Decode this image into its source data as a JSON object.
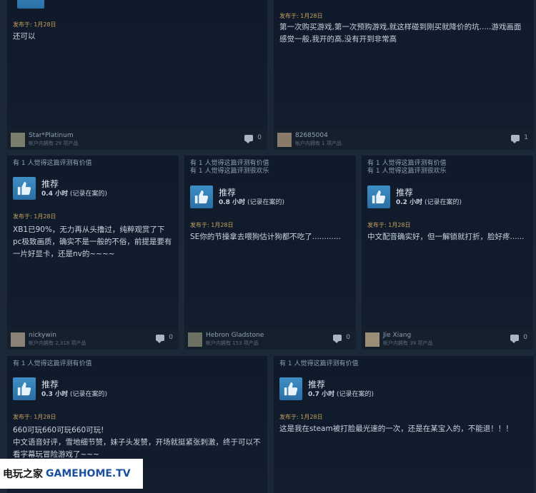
{
  "cards": [
    {
      "id": "c1",
      "helpful": [],
      "recommend": null,
      "date_label": "发布于:",
      "date": "1月28日",
      "text": "还可以",
      "user": "Star*Platinum",
      "owned": "帐户内拥有 29 项产品",
      "comments": "0"
    },
    {
      "id": "c2",
      "helpful": [],
      "recommend": null,
      "date_label": "发布于:",
      "date": "1月28日",
      "text": "第一次购买游戏,第一次预购游戏,就这样碰到刚买就降价的坑.....游戏画面感觉一般,我开的高,没有开到非常高",
      "user": "82685004",
      "owned": "帐户内拥有 1 项产品",
      "comments": "1"
    },
    {
      "id": "c3",
      "helpful": [
        "有 1 人觉得这篇评测有价值"
      ],
      "recommend": {
        "label": "推荐",
        "hours": "0.4 小时",
        "note": "(记录在案的)"
      },
      "date_label": "发布于:",
      "date": "1月28日",
      "text": "XB1已90%，无力再从头撸过，纯粹观赏了下pc极致画质，确实不是一般的不俗，前提是要有一片好显卡，还是nv的~~~~",
      "user": "nickywin",
      "owned": "帐户内拥有 2,318 项产品",
      "comments": "0"
    },
    {
      "id": "c4",
      "helpful": [
        "有 1 人觉得这篇评测有价值",
        "有 1 人觉得这篇评测很欢乐"
      ],
      "recommend": {
        "label": "推荐",
        "hours": "0.8 小时",
        "note": "(记录在案的)"
      },
      "date_label": "发布于:",
      "date": "1月28日",
      "text": "SE你的节操拿去喂狗估计狗都不吃了............",
      "user": "Hebron Gladstone",
      "owned": "帐户内拥有 153 项产品",
      "comments": "0"
    },
    {
      "id": "c5",
      "helpful": [
        "有 1 人觉得这篇评测有价值",
        "有 1 人觉得这篇评测很欢乐"
      ],
      "recommend": {
        "label": "推荐",
        "hours": "0.2 小时",
        "note": "(记录在案的)"
      },
      "date_label": "发布于:",
      "date": "1月28日",
      "text": "中文配音确实好，但一解锁就打折，脸好疼......",
      "user": "Jie Xiang",
      "owned": "帐户内拥有 39 项产品",
      "comments": "0"
    },
    {
      "id": "c6",
      "helpful": [
        "有 1 人觉得这篇评测有价值"
      ],
      "recommend": {
        "label": "推荐",
        "hours": "0.3 小时",
        "note": "(记录在案的)"
      },
      "date_label": "发布于:",
      "date": "1月28日",
      "text": "660可玩660可玩660可玩!\n中文语音好评，雪地细节赞，妹子头发赞，开场就挺紧张刺激，终于可以不看字幕玩冒险游戏了~~~",
      "user": "",
      "owned": "",
      "comments": ""
    },
    {
      "id": "c7",
      "helpful": [
        "有 1 人觉得这篇评测有价值"
      ],
      "recommend": {
        "label": "推荐",
        "hours": "0.7 小时",
        "note": "(记录在案的)"
      },
      "date_label": "发布于:",
      "date": "1月28日",
      "text": "这是我在steam被打脸最光速的一次，还是在某宝入的，不能退！！！",
      "user": "",
      "owned": "",
      "comments": ""
    }
  ],
  "watermark": {
    "cn": "电玩之家",
    "en": "GAMEHOME.TV"
  }
}
